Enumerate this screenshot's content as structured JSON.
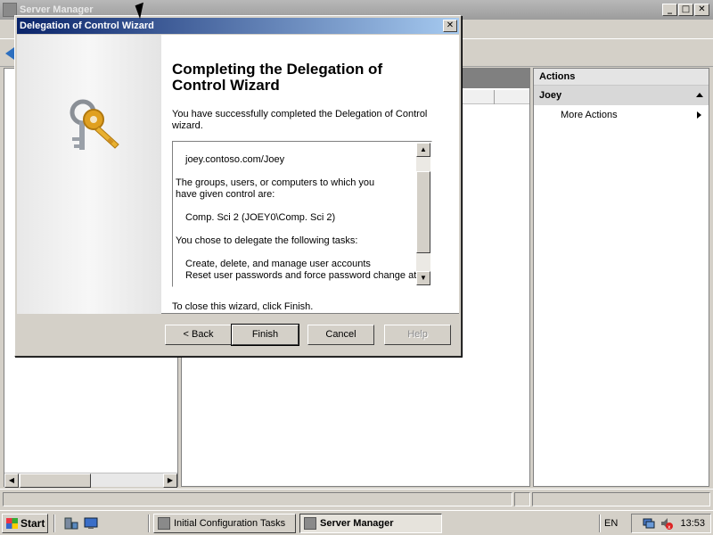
{
  "server_manager": {
    "title": "Server Manager"
  },
  "actions": {
    "title": "Actions",
    "group": "Joey",
    "items": [
      "More Actions"
    ]
  },
  "wizard": {
    "title": "Delegation of Control Wizard",
    "heading": "Completing the Delegation of Control Wizard",
    "intro": "You have successfully completed the Delegation of Control wizard.",
    "summary_lines": [
      "joey.contoso.com/Joey",
      "The groups, users, or computers to which you",
      "have given control are:",
      "Comp. Sci 2 (JOEY0\\Comp. Sci 2)",
      "You chose to delegate the following tasks:",
      "Create, delete, and manage user accounts",
      "Reset user passwords and force password change at next logon"
    ],
    "close_hint": "To close this wizard, click Finish.",
    "buttons": {
      "back": "< Back",
      "finish": "Finish",
      "cancel": "Cancel",
      "help": "Help"
    }
  },
  "taskbar": {
    "start": "Start",
    "tasks": [
      "Initial Configuration Tasks",
      "Server Manager"
    ],
    "active_task": "Server Manager",
    "language": "EN",
    "clock": "13:53"
  },
  "caption_glyphs": {
    "minimize": "_",
    "maximize": "□",
    "close": "✕"
  },
  "colors": {
    "title_active_start": "#0a246a",
    "title_active_end": "#a6caf0",
    "face": "#d4d0c8"
  }
}
